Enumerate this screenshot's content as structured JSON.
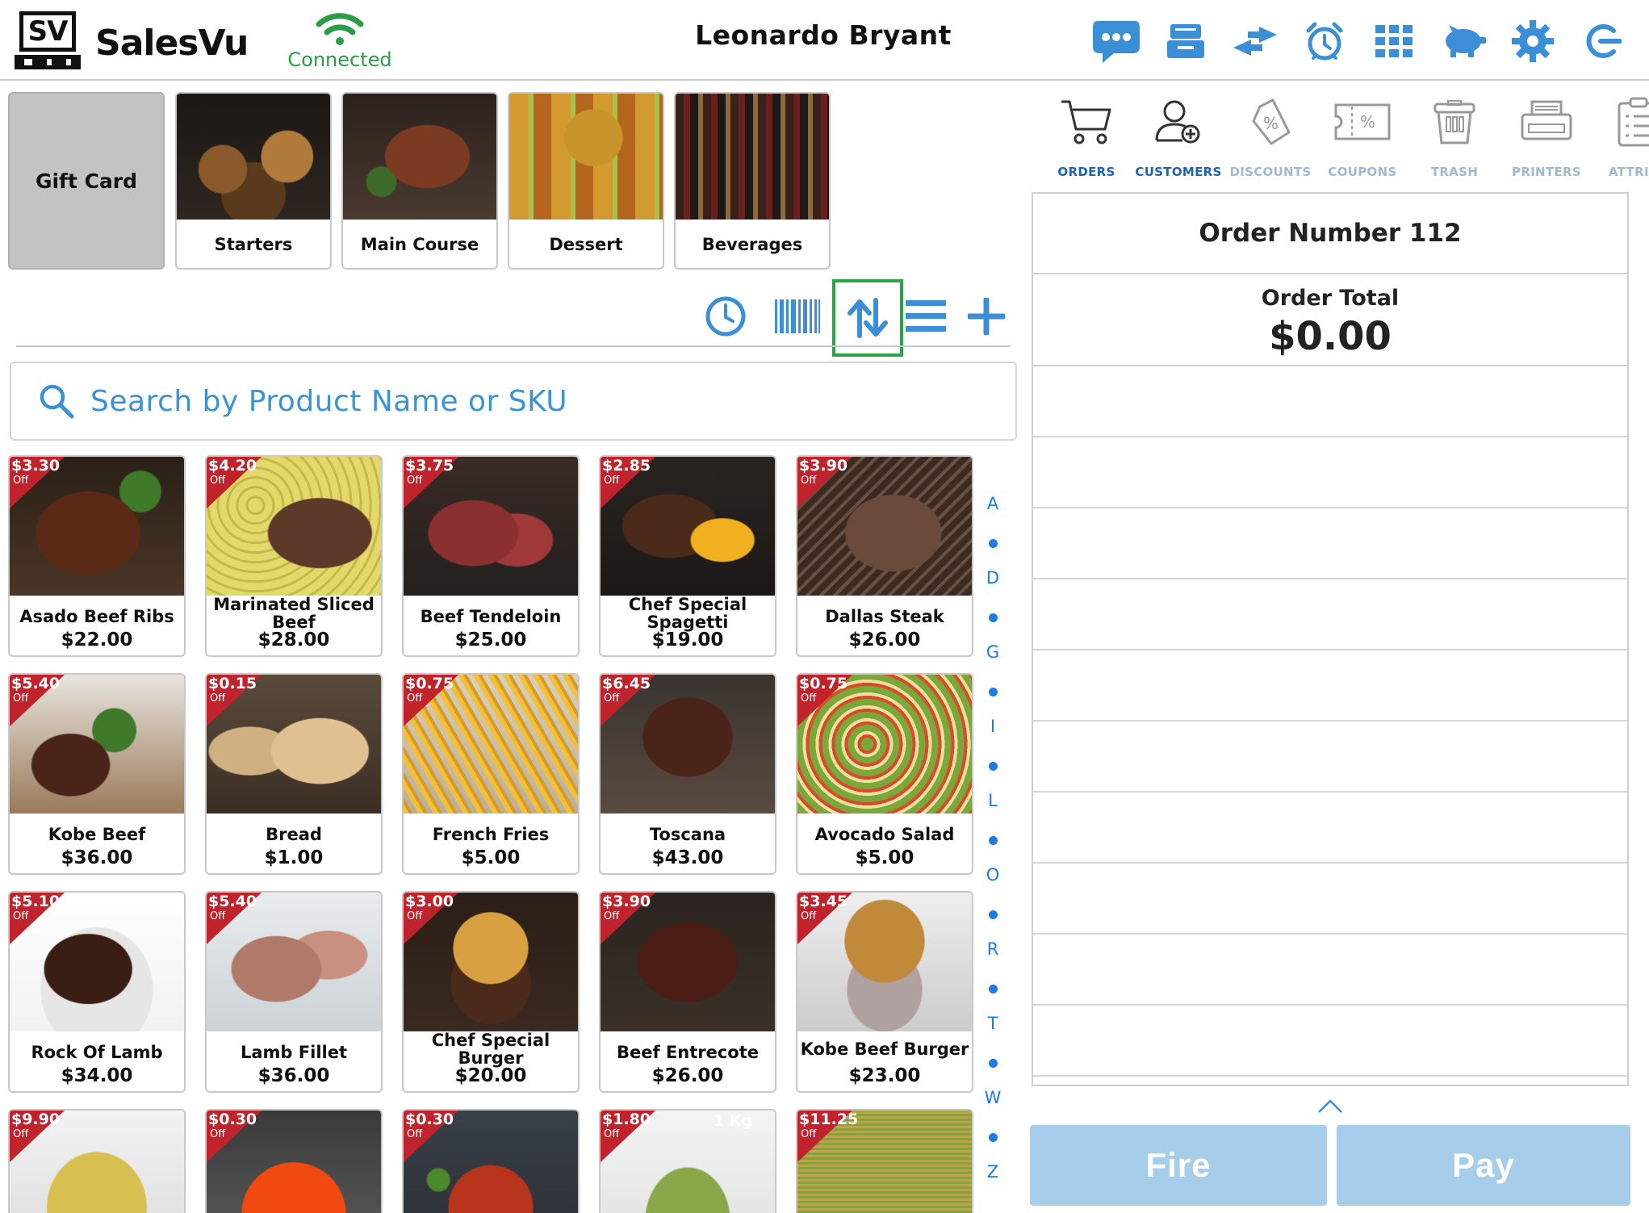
{
  "app": {
    "logo_mark": "SV",
    "brand": "SalesVu",
    "connection_status": "Connected",
    "user_name": "Leonardo Bryant"
  },
  "header_icons": [
    "chat-icon",
    "cash-drawer-icon",
    "transfer-icon",
    "alarm-clock-icon",
    "grid-menu-icon",
    "piggy-bank-icon",
    "settings-gear-icon",
    "logout-icon"
  ],
  "categories": [
    {
      "label": "Gift Card"
    },
    {
      "label": "Starters"
    },
    {
      "label": "Main Course"
    },
    {
      "label": "Dessert"
    },
    {
      "label": "Beverages"
    }
  ],
  "toolbar_icons": [
    "clock-icon",
    "barcode-icon",
    "sort-icon",
    "list-icon",
    "add-icon"
  ],
  "search": {
    "placeholder": "Search by Product Name or SKU"
  },
  "discount_suffix": "Off",
  "products": [
    {
      "name": "Asado Beef Ribs",
      "price": "$22.00",
      "discount": "$3.30"
    },
    {
      "name": "Marinated Sliced Beef",
      "price": "$28.00",
      "discount": "$4.20"
    },
    {
      "name": "Beef Tendeloin",
      "price": "$25.00",
      "discount": "$3.75"
    },
    {
      "name": "Chef Special Spagetti",
      "price": "$19.00",
      "discount": "$2.85"
    },
    {
      "name": "Dallas Steak",
      "price": "$26.00",
      "discount": "$3.90"
    },
    {
      "name": "Kobe Beef",
      "price": "$36.00",
      "discount": "$5.40"
    },
    {
      "name": "Bread",
      "price": "$1.00",
      "discount": "$0.15"
    },
    {
      "name": "French Fries",
      "price": "$5.00",
      "discount": "$0.75"
    },
    {
      "name": "Toscana",
      "price": "$43.00",
      "discount": "$6.45"
    },
    {
      "name": "Avocado Salad",
      "price": "$5.00",
      "discount": "$0.75"
    },
    {
      "name": "Rock Of Lamb",
      "price": "$34.00",
      "discount": "$5.10"
    },
    {
      "name": "Lamb Fillet",
      "price": "$36.00",
      "discount": "$5.40"
    },
    {
      "name": "Chef Special Burger",
      "price": "$20.00",
      "discount": "$3.00"
    },
    {
      "name": "Beef Entrecote",
      "price": "$26.00",
      "discount": "$3.90"
    },
    {
      "name": "Kobe Beef  Burger",
      "price": "$23.00",
      "discount": "$3.45"
    },
    {
      "name": "",
      "price": "",
      "discount": "$9.90"
    },
    {
      "name": "",
      "price": "",
      "discount": "$0.30"
    },
    {
      "name": "",
      "price": "",
      "discount": "$0.30"
    },
    {
      "name": "",
      "price": "",
      "discount": "$1.80",
      "image_text": "1 Kg"
    },
    {
      "name": "",
      "price": "",
      "discount": "$11.25"
    }
  ],
  "alpha_index": [
    "A",
    "D",
    "G",
    "I",
    "L",
    "O",
    "R",
    "T",
    "W",
    "Z"
  ],
  "right_tabs": [
    {
      "label": "ORDERS",
      "icon": "cart-icon",
      "enabled": true
    },
    {
      "label": "CUSTOMERS",
      "icon": "add-customer-icon",
      "enabled": true
    },
    {
      "label": "DISCOUNTS",
      "icon": "discount-tag-icon",
      "enabled": false
    },
    {
      "label": "COUPONS",
      "icon": "coupon-icon",
      "enabled": false
    },
    {
      "label": "TRASH",
      "icon": "trash-icon",
      "enabled": false
    },
    {
      "label": "PRINTERS",
      "icon": "printer-icon",
      "enabled": false
    },
    {
      "label": "ATTRIBU",
      "icon": "attributes-icon",
      "enabled": false
    }
  ],
  "order": {
    "number_label": "Order Number 112",
    "total_label": "Order Total",
    "total_value": "$0.00"
  },
  "actions": {
    "fire": "Fire",
    "pay": "Pay"
  },
  "colors": {
    "accent_blue": "#3a8fd6",
    "connected_green": "#2a9d46",
    "discount_red": "#c0232b",
    "button_disabled": "#a6cde9",
    "active_outline": "#2aa644"
  }
}
